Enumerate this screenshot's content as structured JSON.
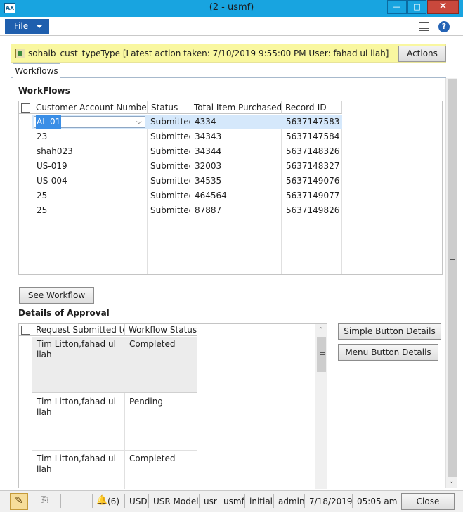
{
  "window": {
    "app_icon": "AX",
    "title": "(2 - usmf)",
    "minimize_glyph": "—",
    "maximize_glyph": "□",
    "close_glyph": "✕"
  },
  "menubar": {
    "file_label": "File",
    "help_glyph": "?"
  },
  "infobar": {
    "text": "sohaib_cust_typeType  [Latest action taken: 7/10/2019 9:55:00 PM  User: fahad ul llah]",
    "actions_label": "Actions"
  },
  "tabs": [
    {
      "label": "Workflows",
      "selected": true
    }
  ],
  "workflows": {
    "heading": "WorkFlows",
    "columns": [
      "Customer Account Number",
      "Status",
      "Total Item Purchased",
      "Record-ID"
    ],
    "rows": [
      [
        "AL-01",
        "Submitted",
        "4334",
        "5637147583"
      ],
      [
        "23",
        "Submitted",
        "34343",
        "5637147584"
      ],
      [
        "shah023",
        "Submitted",
        "34344",
        "5637148326"
      ],
      [
        "US-019",
        "Submitted",
        "32003",
        "5637148327"
      ],
      [
        "US-004",
        "Submitted",
        "34535",
        "5637149076"
      ],
      [
        "25",
        "Submitted",
        "464564",
        "5637149077"
      ],
      [
        "25",
        "Submitted",
        "87887",
        "5637149826"
      ]
    ],
    "selected_row": 0
  },
  "see_workflow_label": "See Workflow",
  "approval": {
    "heading": "Details of Approval",
    "columns": [
      "Request Submitted to",
      "Workflow Status"
    ],
    "rows": [
      [
        "Tim Litton,fahad ul llah",
        "Completed"
      ],
      [
        "Tim Litton,fahad ul llah",
        "Pending"
      ],
      [
        "Tim Litton,fahad ul llah",
        "Completed"
      ]
    ]
  },
  "side_buttons": {
    "simple": "Simple Button Details",
    "menu": "Menu Button Details"
  },
  "statusbar": {
    "notifications": "(6)",
    "currency": "USD",
    "model": "USR Model",
    "layer": "usr",
    "company": "usmf",
    "partition": "initial",
    "user": "admin",
    "date": "7/18/2019",
    "time": "05:05 am",
    "close_label": "Close"
  },
  "colors": {
    "titlebar": "#18a4e0",
    "file_button": "#1f5fae",
    "infobar": "#f9f7a0",
    "selected_row": "#d5e8fb"
  }
}
